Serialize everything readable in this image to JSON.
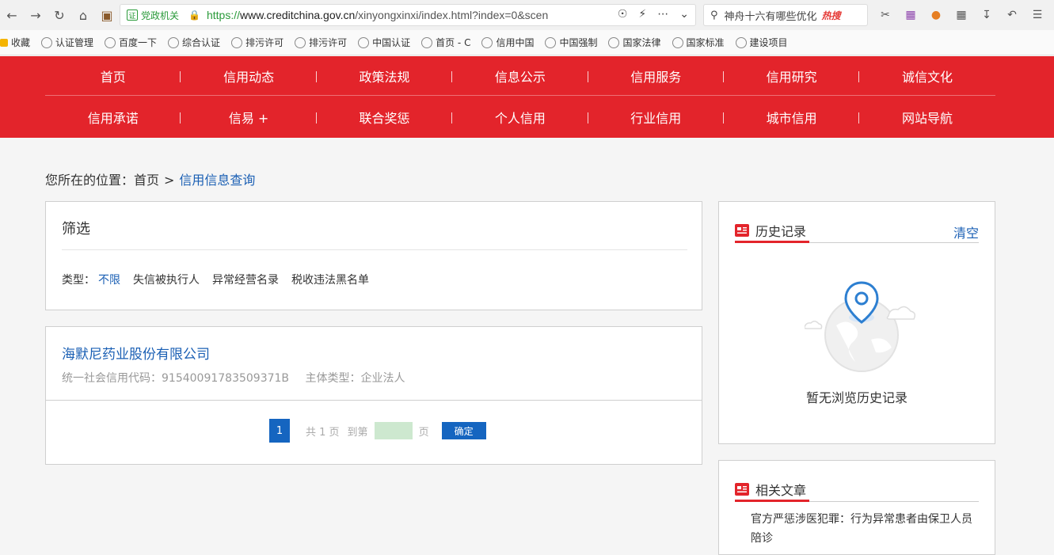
{
  "browser": {
    "gov_badge": "党政机关",
    "url_scheme": "https://",
    "url_host": "www.creditchina.gov.cn",
    "url_path": "/xinyongxinxi/index.html?index=0&scen",
    "search_text": "神舟十六有哪些优化",
    "search_hot": "热搜",
    "bookmarks": [
      "收藏",
      "认证管理",
      "百度一下",
      "综合认证",
      "排污许可",
      "排污许可",
      "中国认证",
      "首页 - C",
      "信用中国",
      "中国强制",
      "国家法律",
      "国家标准",
      "建设项目"
    ]
  },
  "nav": {
    "row1": [
      "首页",
      "信用动态",
      "政策法规",
      "信息公示",
      "信用服务",
      "信用研究",
      "诚信文化"
    ],
    "row2": [
      "信用承诺",
      "信易 +",
      "联合奖惩",
      "个人信用",
      "行业信用",
      "城市信用",
      "网站导航"
    ]
  },
  "breadcrumb": {
    "prefix": "您所在的位置：首页",
    "sep": ">",
    "current": "信用信息查询"
  },
  "filter": {
    "title": "筛选",
    "type_label": "类型：",
    "types": [
      "不限",
      "失信被执行人",
      "异常经营名录",
      "税收违法黑名单"
    ]
  },
  "result": {
    "company": "海默尼药业股份有限公司",
    "credit_code": "统一社会信用代码：91540091783509371B",
    "entity_type": "主体类型：企业法人"
  },
  "pager": {
    "current_page": "1",
    "total": "共 1 页",
    "goto": "到第",
    "page_unit": "页",
    "confirm": "确定"
  },
  "history": {
    "title": "历史记录",
    "clear": "清空",
    "empty": "暂无浏览历史记录"
  },
  "related": {
    "title": "相关文章",
    "link": "官方严惩涉医犯罪：行为异常患者由保卫人员陪诊"
  }
}
